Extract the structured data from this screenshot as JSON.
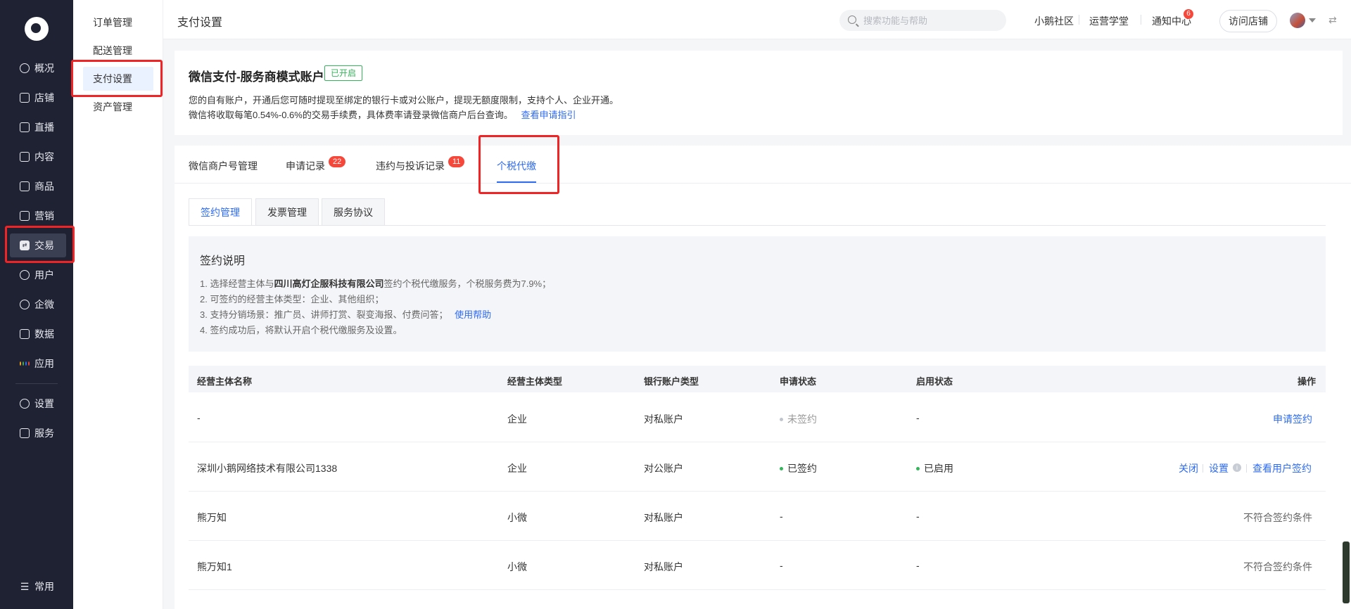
{
  "nav": {
    "items": [
      {
        "label": "概况",
        "icon": "pie-chart-icon"
      },
      {
        "label": "店铺",
        "icon": "store-icon"
      },
      {
        "label": "直播",
        "icon": "live-icon"
      },
      {
        "label": "内容",
        "icon": "document-icon"
      },
      {
        "label": "商品",
        "icon": "goods-icon"
      },
      {
        "label": "营销",
        "icon": "megaphone-icon"
      },
      {
        "label": "交易",
        "icon": "transaction-icon"
      },
      {
        "label": "用户",
        "icon": "user-icon"
      },
      {
        "label": "企微",
        "icon": "wecom-icon"
      },
      {
        "label": "数据",
        "icon": "data-icon"
      },
      {
        "label": "应用",
        "icon": "apps-icon"
      },
      {
        "label": "设置",
        "icon": "gear-icon"
      },
      {
        "label": "服务",
        "icon": "service-icon"
      },
      {
        "label": "常用",
        "icon": "list-icon"
      }
    ],
    "active": "交易"
  },
  "submenu": {
    "items": [
      "订单管理",
      "配送管理",
      "支付设置",
      "资产管理"
    ],
    "active": "支付设置"
  },
  "header": {
    "title": "支付设置",
    "search_placeholder": "搜索功能与帮助",
    "links": [
      "小鹅社区",
      "运营学堂",
      "通知中心"
    ],
    "notice_count": "6",
    "visit_button": "访问店铺"
  },
  "account": {
    "title": "微信支付-服务商模式账户",
    "badge": "已开启",
    "desc1": "您的自有账户，开通后您可随时提现至绑定的银行卡或对公账户，提现无额度限制，支持个人、企业开通。",
    "desc2": "微信将收取每笔0.54%-0.6%的交易手续费，具体费率请登录微信商户后台查询。",
    "guide_link": "查看申请指引"
  },
  "tabs": {
    "items": [
      {
        "label": "微信商户号管理"
      },
      {
        "label": "申请记录",
        "badge": "22"
      },
      {
        "label": "违约与投诉记录",
        "badge": "11"
      },
      {
        "label": "个税代缴"
      }
    ],
    "active": "个税代缴"
  },
  "sub_tabs": {
    "items": [
      "签约管理",
      "发票管理",
      "服务协议"
    ],
    "active": "签约管理"
  },
  "info": {
    "title": "签约说明",
    "line1_prefix": "1. 选择经营主体与",
    "line1_company": "四川高灯企服科技有限公司",
    "line1_suffix": "签约个税代缴服务，个税服务费为7.9%；",
    "line2": "2. 可签约的经营主体类型：企业、其他组织；",
    "line3": "3. 支持分销场景：推广员、讲师打赏、裂变海报、付费问答；",
    "line3_link": "使用帮助",
    "line4": "4. 签约成功后，将默认开启个税代缴服务及设置。"
  },
  "table": {
    "headers": [
      "经营主体名称",
      "经营主体类型",
      "银行账户类型",
      "申请状态",
      "启用状态",
      "操作"
    ],
    "rows": [
      {
        "name": "-",
        "type": "企业",
        "bank": "对私账户",
        "apply": "未签约",
        "enable": "-",
        "op": "申请签约"
      },
      {
        "name": "深圳小鹅网络技术有限公司1338",
        "type": "企业",
        "bank": "对公账户",
        "apply": "已签约",
        "enable": "已启用",
        "op_close": "关闭",
        "op_settings": "设置",
        "op_view": "查看用户签约"
      },
      {
        "name": "熊万知",
        "type": "小微",
        "bank": "对私账户",
        "apply": "-",
        "enable": "-",
        "op": "不符合签约条件"
      },
      {
        "name": "熊万知1",
        "type": "小微",
        "bank": "对私账户",
        "apply": "-",
        "enable": "-",
        "op": "不符合签约条件"
      }
    ]
  },
  "colors": {
    "nav_bg": "#1f2233",
    "accent": "#2e6bf0",
    "success": "#34b55a",
    "badge": "#f5483b",
    "highlight": "#f02424"
  }
}
